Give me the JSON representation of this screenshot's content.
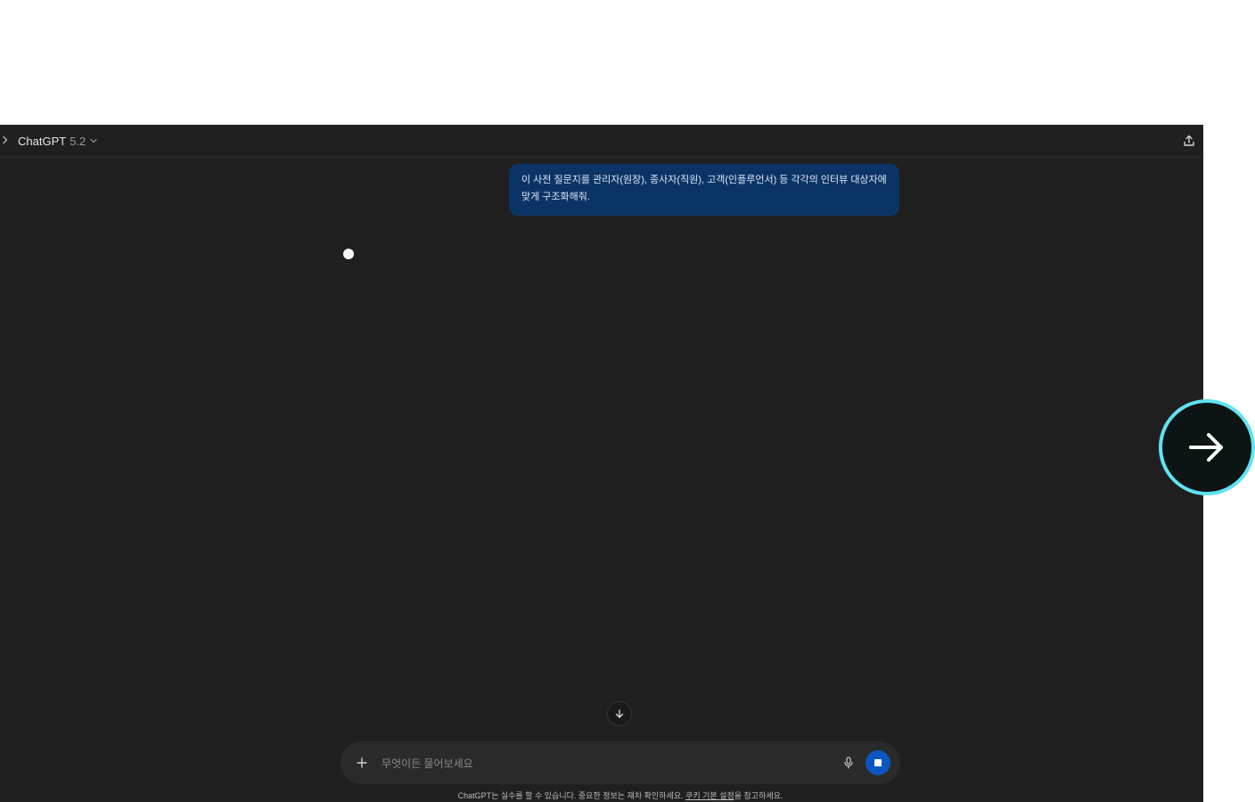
{
  "app": {
    "name": "ChatGPT",
    "version": "5.2"
  },
  "conversation": {
    "user_message": "이 사전 질문지를 관리자(원장), 종사자(직원), 고객(인플루언서) 등 각각의 인터뷰 대상자에 맞게 구조화해줘."
  },
  "composer": {
    "placeholder": "무엇이든 물어보세요"
  },
  "disclaimer": {
    "text_before": "ChatGPT는 실수를 할 수 있습니다. 중요한 정보는 재차 확인하세요. ",
    "link": "쿠키 기본 설정",
    "text_after": "을 참고하세요."
  },
  "colors": {
    "app_background": "#1f1f1f",
    "user_bubble": "#0b3466",
    "composer_background": "#2a2a2a",
    "stop_button": "#0b57c0",
    "overlay_ring": "#5fe3f2"
  },
  "icons": {
    "sidebar_toggle": "chevron-right-icon",
    "model_dropdown": "chevron-down-icon",
    "share": "share-icon",
    "scroll_down": "arrow-down-icon",
    "attach": "plus-icon",
    "voice": "microphone-icon",
    "stop": "stop-icon",
    "overlay_next": "arrow-right-icon"
  }
}
